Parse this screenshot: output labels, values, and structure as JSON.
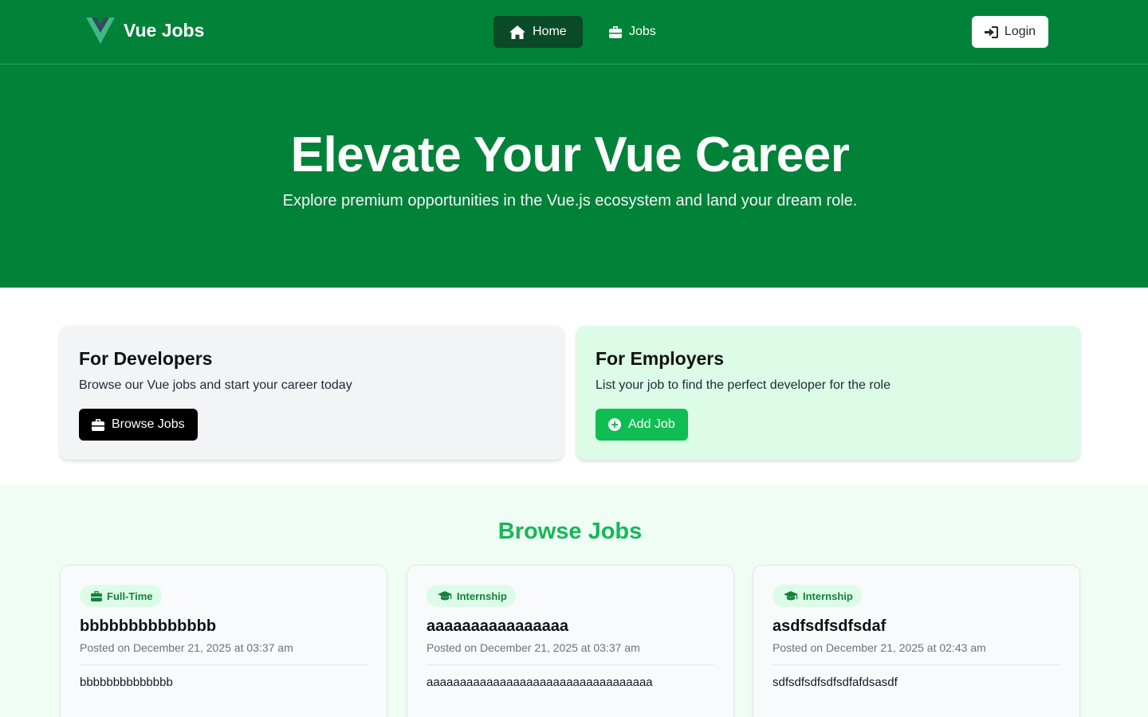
{
  "nav": {
    "brand": "Vue Jobs",
    "links": [
      {
        "label": "Home",
        "icon": "home-icon",
        "active": true
      },
      {
        "label": "Jobs",
        "icon": "briefcase-icon",
        "active": false
      }
    ],
    "login_label": "Login"
  },
  "hero": {
    "title": "Elevate Your Vue Career",
    "subtitle": "Explore premium opportunities in the Vue.js ecosystem and land your dream role."
  },
  "cards": {
    "developers": {
      "title": "For Developers",
      "text": "Browse our Vue jobs and start your career today",
      "button": "Browse Jobs"
    },
    "employers": {
      "title": "For Employers",
      "text": "List your job to find the perfect developer for the role",
      "button": "Add Job"
    }
  },
  "browse": {
    "title": "Browse Jobs",
    "jobs": [
      {
        "type": "Full-Time",
        "icon": "briefcase-icon",
        "title": "bbbbbbbbbbbbbb",
        "posted": "Posted on December 21, 2025 at 03:37 am",
        "description": "bbbbbbbbbbbbbb"
      },
      {
        "type": "Internship",
        "icon": "graduation-cap-icon",
        "title": "aaaaaaaaaaaaaaaa",
        "posted": "Posted on December 21, 2025 at 03:37 am",
        "description": "aaaaaaaaaaaaaaaaaaaaaaaaaaaaaaaaaa"
      },
      {
        "type": "Internship",
        "icon": "graduation-cap-icon",
        "title": "asdfsdfsdfsdaf",
        "posted": "Posted on December 21, 2025 at 02:43 am",
        "description": "sdfsdfsdfsdfsdfafdsasdf"
      }
    ]
  },
  "colors": {
    "primary_green": "#008238",
    "active_nav": "#0a4a27",
    "accent_green": "#14b856",
    "add_button": "#0fbd52",
    "employer_card": "#dcfce7",
    "developer_card": "#f3f4f6",
    "browse_bg": "#f0fdf4"
  }
}
